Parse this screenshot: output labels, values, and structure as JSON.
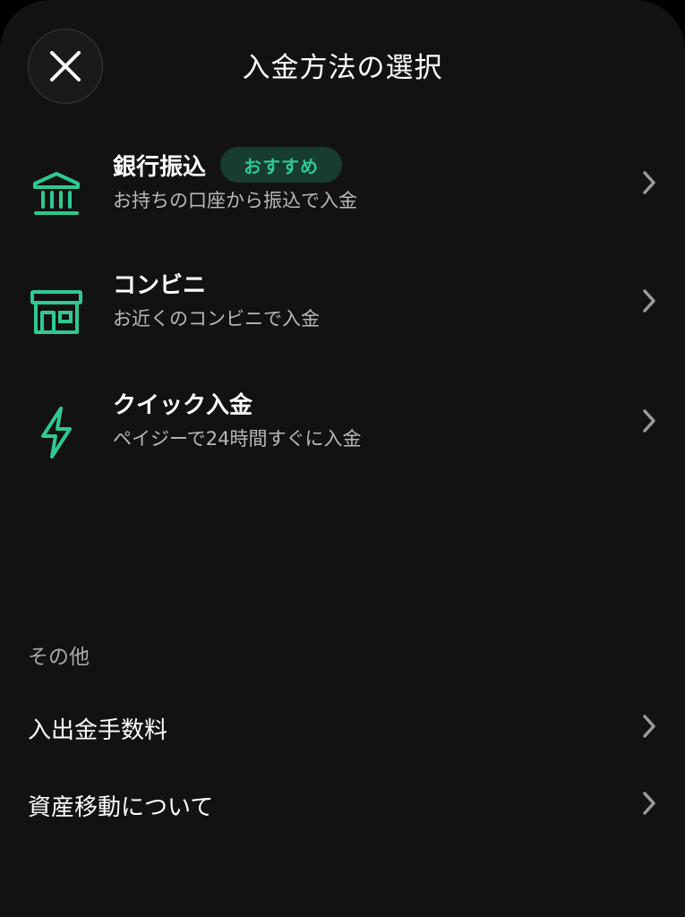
{
  "header": {
    "title": "入金方法の選択",
    "close_icon": "close-icon"
  },
  "methods": [
    {
      "icon": "bank-icon",
      "name": "銀行振込",
      "badge": "おすすめ",
      "description": "お持ちの口座から振込で入金"
    },
    {
      "icon": "store-icon",
      "name": "コンビニ",
      "description": "お近くのコンビニで入金"
    },
    {
      "icon": "lightning-icon",
      "name": "クイック入金",
      "description": "ペイジーで24時間すぐに入金"
    }
  ],
  "other": {
    "label": "その他",
    "links": [
      {
        "label": "入出金手数料"
      },
      {
        "label": "資産移動について"
      }
    ]
  },
  "colors": {
    "accent": "#2fc98f",
    "badge_bg": "#173c30",
    "background": "#121212",
    "secondary_text": "#b8b8b8",
    "chevron": "#9a9a9a"
  }
}
